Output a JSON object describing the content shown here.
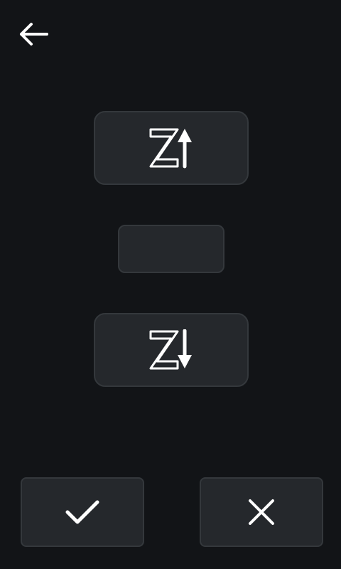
{
  "screen": {
    "background_color": "#121417",
    "button_color": "#25282c",
    "button_border_color": "#34383c",
    "icon_color": "#ffffff"
  },
  "header": {
    "back_icon": "arrow-left-icon"
  },
  "z_axis": {
    "up_icon": "z-arrow-up-icon",
    "value": "",
    "down_icon": "z-arrow-down-icon"
  },
  "footer": {
    "confirm_icon": "checkmark-icon",
    "cancel_icon": "close-icon"
  }
}
